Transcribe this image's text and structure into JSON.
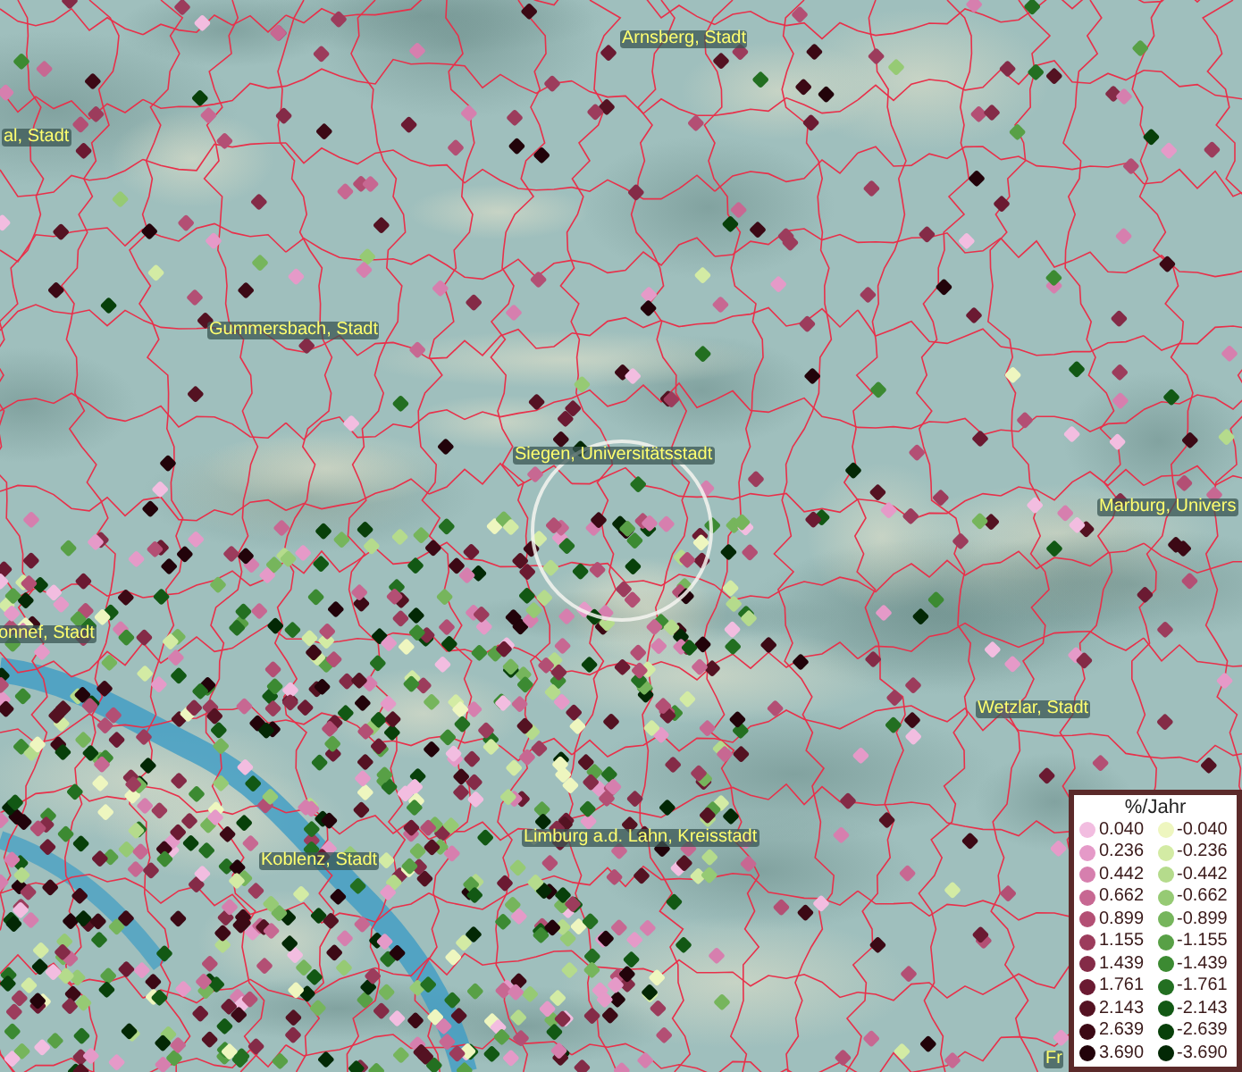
{
  "map": {
    "places": [
      {
        "name": "Arnsberg, Stadt"
      },
      {
        "name": "al, Stadt"
      },
      {
        "name": "Gummersbach, Stadt"
      },
      {
        "name": "Siegen, Universitätsstadt"
      },
      {
        "name": "Marburg, Univers"
      },
      {
        "name": "onnef, Stadt"
      },
      {
        "name": "Wetzlar, Stadt"
      },
      {
        "name": "Koblenz, Stadt"
      },
      {
        "name": "Limburg a.d. Lahn, Kreisstadt"
      },
      {
        "name": "Fr"
      }
    ]
  },
  "legend": {
    "title": "%/Jahr",
    "positive": [
      {
        "label": "0.040",
        "color": "#f2bde0"
      },
      {
        "label": "0.236",
        "color": "#e59ac8"
      },
      {
        "label": "0.442",
        "color": "#d67fae"
      },
      {
        "label": "0.662",
        "color": "#c76892"
      },
      {
        "label": "0.899",
        "color": "#b34f74"
      },
      {
        "label": "1.155",
        "color": "#9c3c5c"
      },
      {
        "label": "1.439",
        "color": "#842b47"
      },
      {
        "label": "1.761",
        "color": "#6b1a32"
      },
      {
        "label": "2.143",
        "color": "#541222"
      },
      {
        "label": "2.639",
        "color": "#3c0915"
      },
      {
        "label": "3.690",
        "color": "#22030a"
      }
    ],
    "negative": [
      {
        "label": "-0.040",
        "color": "#eef6bf"
      },
      {
        "label": "-0.236",
        "color": "#d3eba4"
      },
      {
        "label": "-0.442",
        "color": "#b5db8c"
      },
      {
        "label": "-0.662",
        "color": "#96ca74"
      },
      {
        "label": "-0.899",
        "color": "#76b55c"
      },
      {
        "label": "-1.155",
        "color": "#58a046"
      },
      {
        "label": "-1.439",
        "color": "#3c8a32"
      },
      {
        "label": "-1.761",
        "color": "#236f21"
      },
      {
        "label": "-2.143",
        "color": "#125814"
      },
      {
        "label": "-2.639",
        "color": "#08400a"
      },
      {
        "label": "-3.690",
        "color": "#032805"
      }
    ]
  }
}
